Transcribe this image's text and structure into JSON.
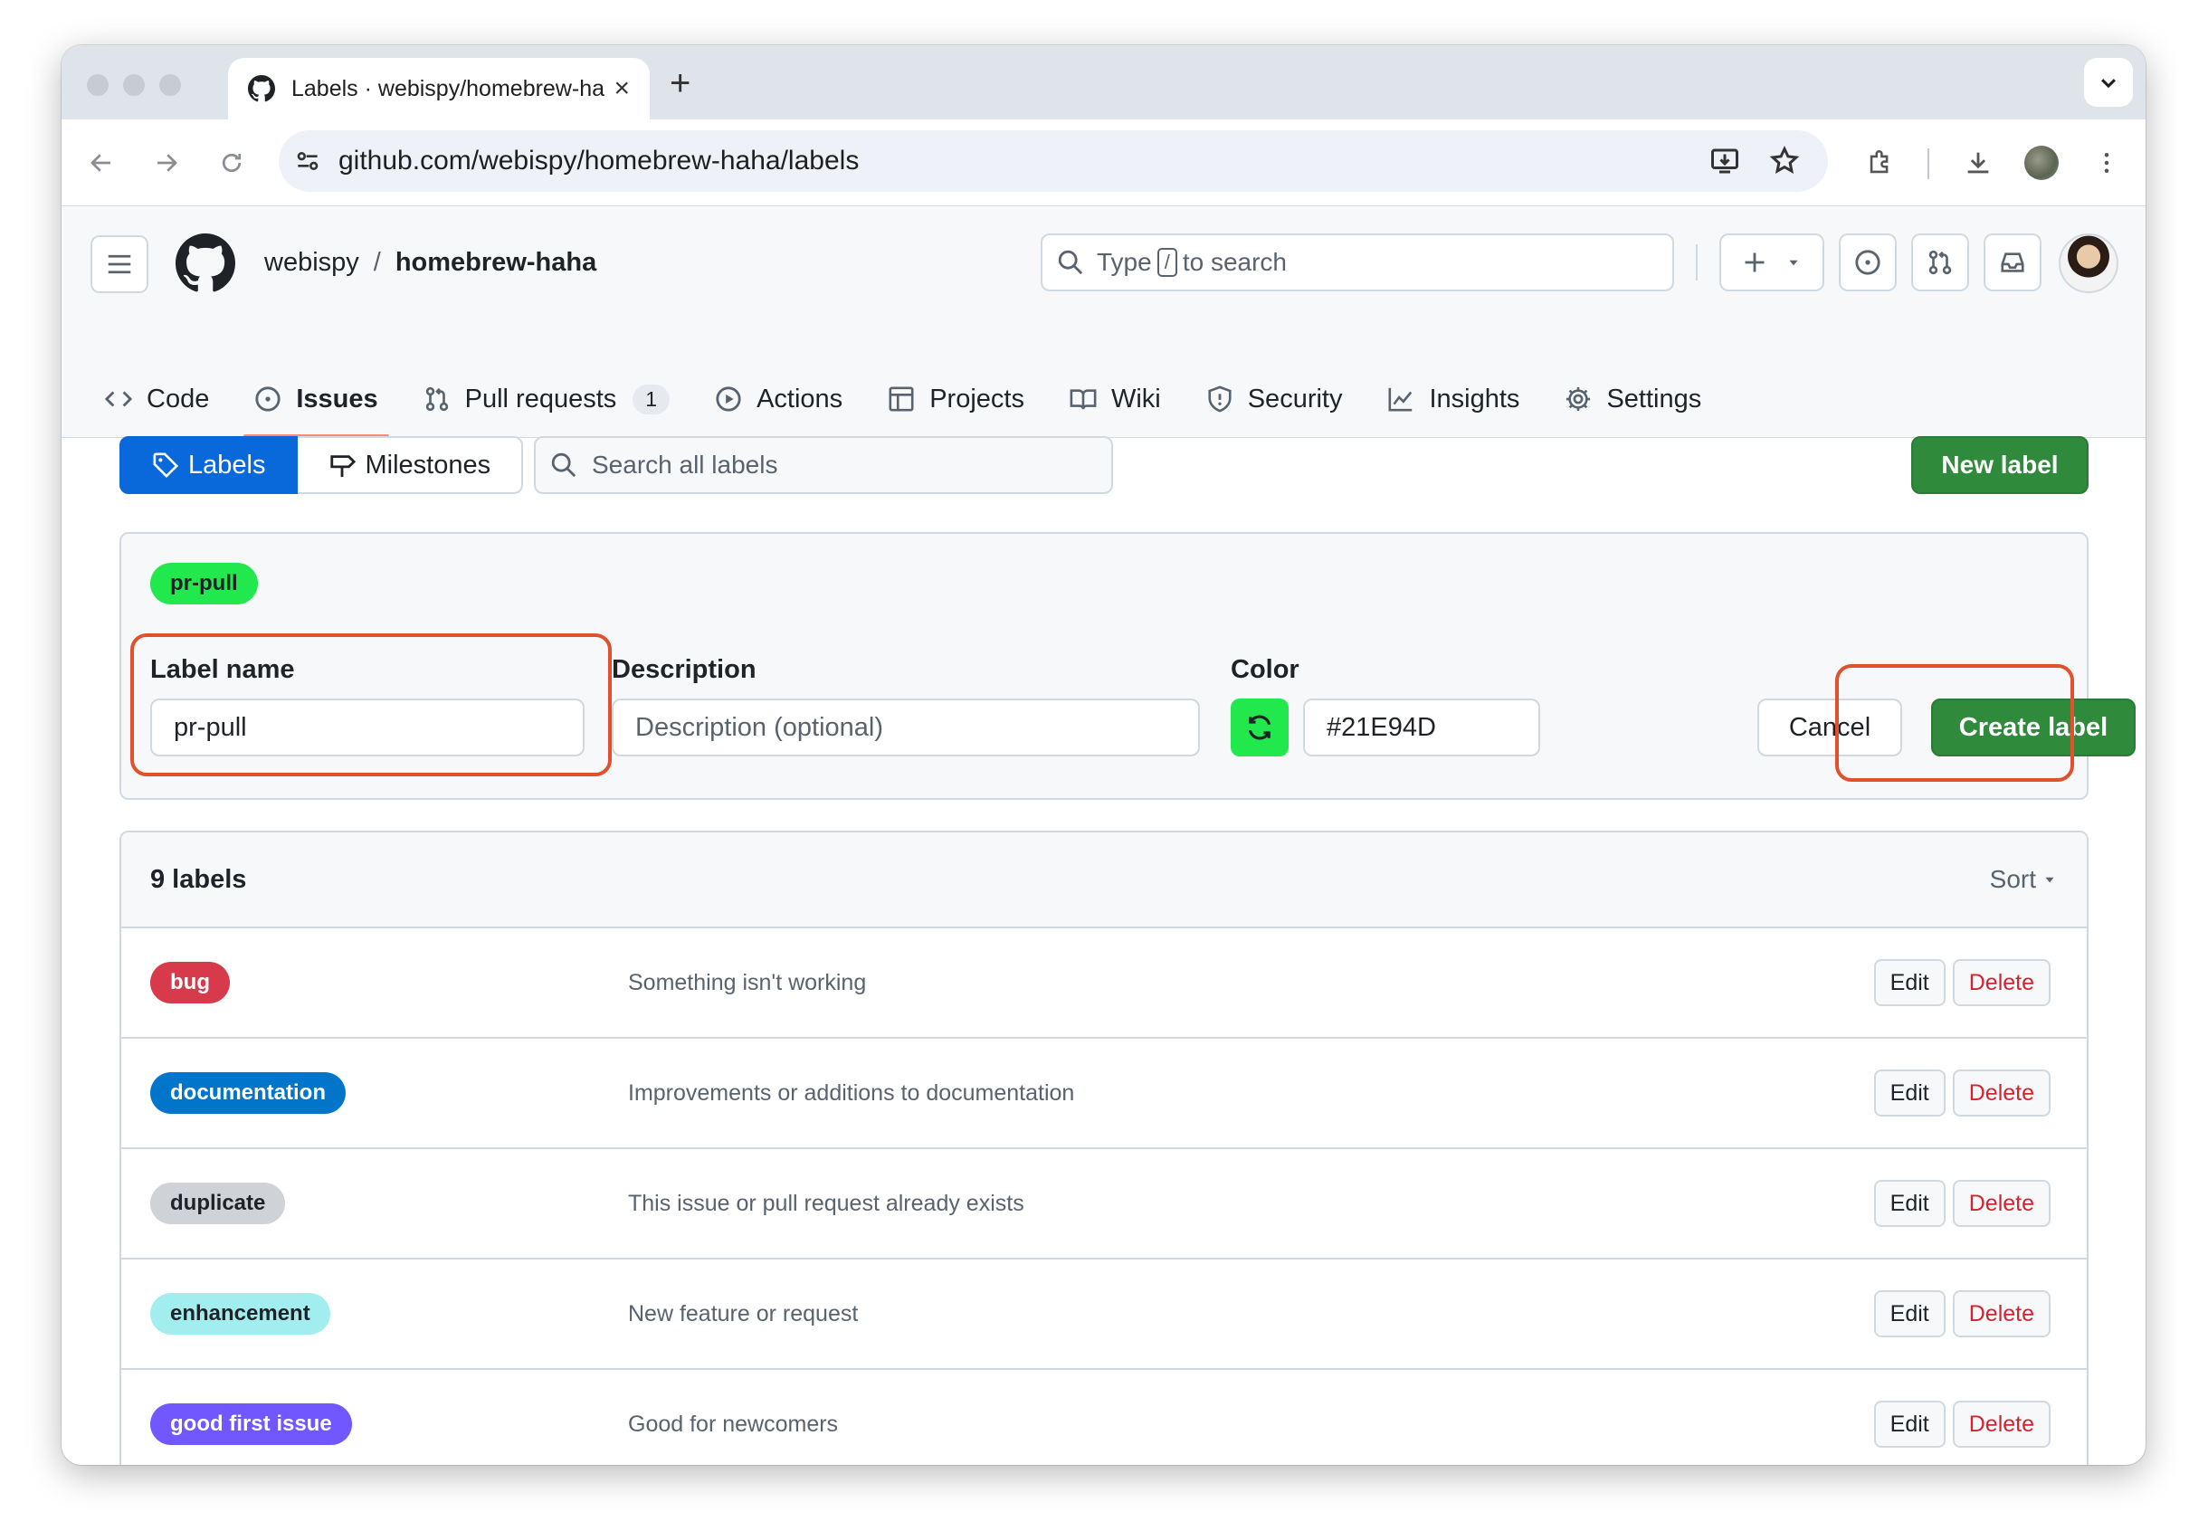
{
  "browser": {
    "tab_title": "Labels · webispy/homebrew-haha",
    "url": "github.com/webispy/homebrew-haha/labels"
  },
  "header": {
    "owner": "webispy",
    "separator": "/",
    "repo": "homebrew-haha",
    "search": {
      "prefix": "Type",
      "key": "/",
      "suffix": "to search"
    }
  },
  "repo_nav": {
    "items": [
      {
        "label": "Code",
        "icon": "code-icon"
      },
      {
        "label": "Issues",
        "icon": "issue-icon",
        "active": true
      },
      {
        "label": "Pull requests",
        "icon": "pull-request-icon",
        "counter": "1"
      },
      {
        "label": "Actions",
        "icon": "play-icon"
      },
      {
        "label": "Projects",
        "icon": "table-icon"
      },
      {
        "label": "Wiki",
        "icon": "book-icon"
      },
      {
        "label": "Security",
        "icon": "shield-icon"
      },
      {
        "label": "Insights",
        "icon": "graph-icon"
      },
      {
        "label": "Settings",
        "icon": "gear-icon"
      }
    ]
  },
  "subnav": {
    "labels": "Labels",
    "milestones": "Milestones",
    "search_placeholder": "Search all labels",
    "new_label": "New label"
  },
  "form": {
    "preview": "pr-pull",
    "preview_color": "#21E94D",
    "name_label": "Label name",
    "name_value": "pr-pull",
    "description_label": "Description",
    "description_placeholder": "Description (optional)",
    "color_label": "Color",
    "color_value": "#21E94D",
    "cancel": "Cancel",
    "create": "Create label"
  },
  "labels_list": {
    "count": "9 labels",
    "sort": "Sort",
    "edit": "Edit",
    "delete": "Delete",
    "items": [
      {
        "name": "bug",
        "color": "#d73a4a",
        "text_color": "#ffffff",
        "description": "Something isn't working"
      },
      {
        "name": "documentation",
        "color": "#0075ca",
        "text_color": "#ffffff",
        "description": "Improvements or additions to documentation"
      },
      {
        "name": "duplicate",
        "color": "#cfd3d7",
        "text_color": "#1f2328",
        "description": "This issue or pull request already exists"
      },
      {
        "name": "enhancement",
        "color": "#a2eeef",
        "text_color": "#1f2328",
        "description": "New feature or request"
      },
      {
        "name": "good first issue",
        "color": "#7057ff",
        "text_color": "#ffffff",
        "description": "Good for newcomers"
      }
    ]
  },
  "colors": {
    "accent_blue": "#0969da",
    "primary_green": "#2f8a3c",
    "highlight_red": "#e2502d"
  }
}
